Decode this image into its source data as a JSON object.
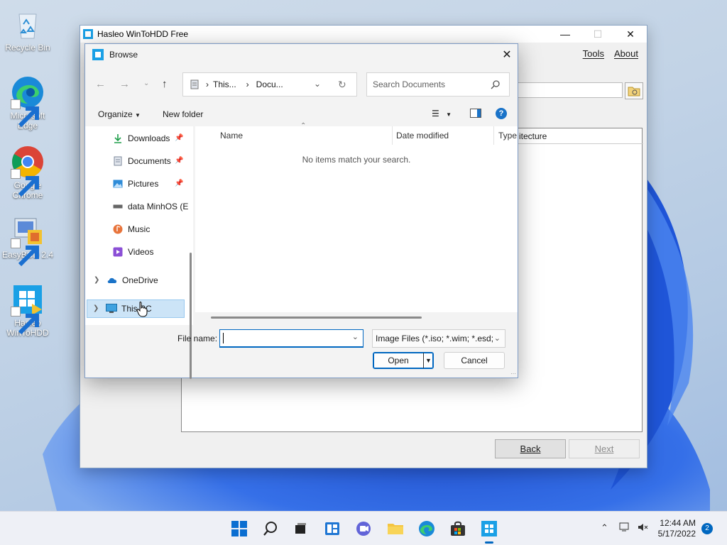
{
  "desktop": {
    "icons": [
      {
        "label": "Recycle Bin"
      },
      {
        "label": "Microsoft Edge"
      },
      {
        "label": "Google Chrome"
      },
      {
        "label": "EasyBCD 2.4"
      },
      {
        "label": "Hasleo WinToHDD"
      }
    ]
  },
  "main_window": {
    "title": "Hasleo WinToHDD Free",
    "menu": {
      "tools": "Tools",
      "about": "About"
    },
    "list_header": "itecture",
    "back_label": "Back",
    "next_label": "Next"
  },
  "dialog": {
    "title": "Browse",
    "breadcrumb": [
      "This...",
      "Docu..."
    ],
    "search_placeholder": "Search Documents",
    "organize_label": "Organize",
    "new_folder_label": "New folder",
    "nav_items": [
      {
        "label": "Downloads",
        "pinned": true
      },
      {
        "label": "Documents",
        "pinned": true
      },
      {
        "label": "Pictures",
        "pinned": true
      },
      {
        "label": "data MinhOS (E"
      },
      {
        "label": "Music"
      },
      {
        "label": "Videos"
      },
      {
        "label": "OneDrive"
      },
      {
        "label": "This PC"
      }
    ],
    "columns": {
      "name": "Name",
      "date_modified": "Date modified",
      "type": "Type"
    },
    "empty_message": "No items match your search.",
    "file_name_label": "File name:",
    "file_name_value": "",
    "filter_value": "Image Files (*.iso; *.wim; *.esd;",
    "open_label": "Open",
    "cancel_label": "Cancel"
  },
  "taskbar": {
    "time": "12:44 AM",
    "date": "5/17/2022",
    "notifications": "2"
  },
  "colors": {
    "accent": "#0067c0",
    "selection": "#cce4f7"
  }
}
